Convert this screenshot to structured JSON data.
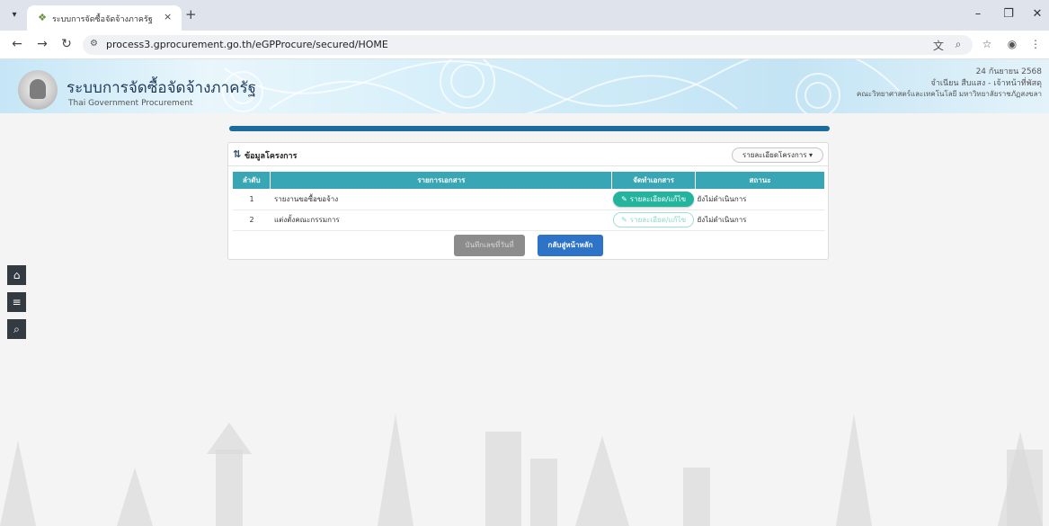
{
  "browser": {
    "tab_title": "ระบบการจัดซื้อจัดจ้างภาครัฐ",
    "url": "process3.gprocurement.go.th/eGPProcure/secured/HOME",
    "icons": {
      "tab_menu": "▾",
      "tab_close": "×",
      "new_tab": "+",
      "minimize": "–",
      "restore": "❐",
      "close": "✕",
      "back": "←",
      "forward": "→",
      "reload": "↻",
      "site_info": "⚙",
      "translate": "文",
      "zoom": "⌕",
      "bookmark": "☆",
      "profile": "◉",
      "menu": "⋮"
    }
  },
  "header": {
    "title": "ระบบการจัดซื้อจัดจ้างภาครัฐ",
    "subtitle": "Thai Government Procurement",
    "date": "24 กันยายน 2568",
    "user": "จำเนียน สืบแสง - เจ้าหน้าที่พัสดุ",
    "organization": "คณะวิทยาศาสตร์และเทคโนโลยี มหาวิทยาลัยราชภัฏสงขลา"
  },
  "progress": {
    "value": 1.0,
    "color": "#1b6c9c"
  },
  "panel": {
    "icon": "⇅",
    "title": "ข้อมูลโครงการ",
    "detail_button": "รายละเอียดโครงการ ▾",
    "columns": [
      "ลำดับ",
      "รายการเอกสาร",
      "จัดทำเอกสาร",
      "สถานะ"
    ],
    "rows": [
      {
        "num": "1",
        "name": "รายงานขอซื้อขอจ้าง",
        "action": "รายละเอียด/แก้ไข",
        "action_state": "active",
        "status": "ยังไม่ดำเนินการ"
      },
      {
        "num": "2",
        "name": "แต่งตั้งคณะกรรมการ",
        "action": "รายละเอียด/แก้ไข",
        "action_state": "disabled",
        "status": "ยังไม่ดำเนินการ"
      }
    ],
    "save_button": "บันทึกเลขที่วันที่",
    "home_button": "กลับสู่หน้าหลัก"
  },
  "side_buttons": [
    {
      "name": "home-icon",
      "glyph": "⌂"
    },
    {
      "name": "menu-icon",
      "glyph": "≡"
    },
    {
      "name": "search-icon",
      "glyph": "⌕"
    }
  ],
  "colors": {
    "table_header": "#38a6b4",
    "action_active": "#23b49e",
    "home_button": "#2d73c7",
    "save_button": "#8c8c8c",
    "side_button": "#333a42"
  }
}
